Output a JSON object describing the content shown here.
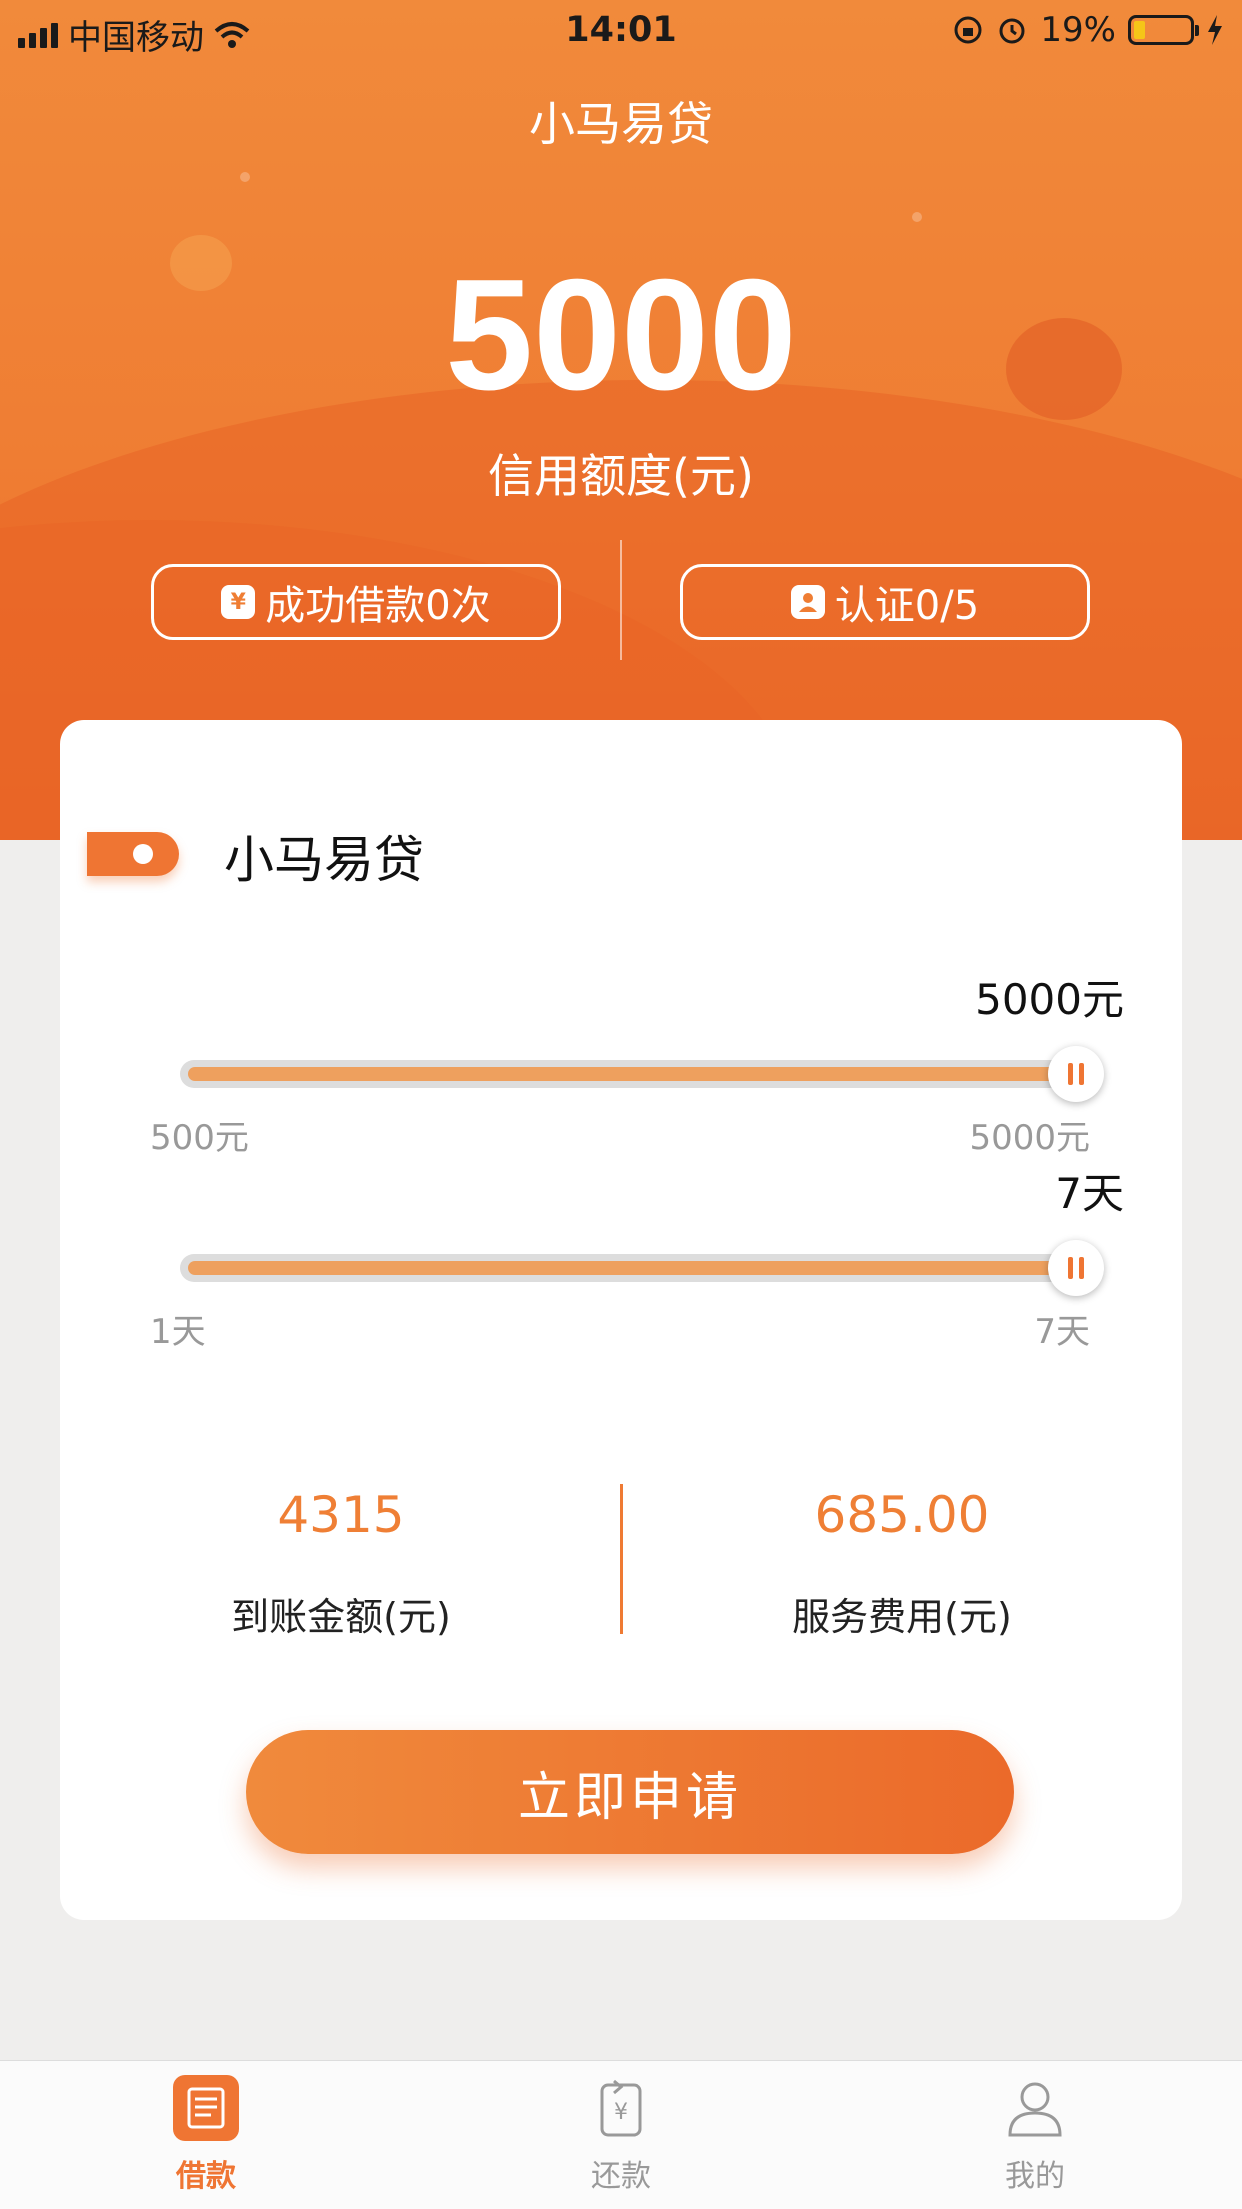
{
  "status_bar": {
    "carrier": "中国移动",
    "time": "14:01",
    "battery": "19%"
  },
  "header": {
    "app_title": "小马易贷",
    "credit_amount": "5000",
    "credit_label": "信用额度(元)",
    "loans_button": "成功借款0次",
    "auth_button": "认证0/5"
  },
  "card": {
    "title": "小马易贷",
    "amount_slider": {
      "value_label": "5000元",
      "min_label": "500元",
      "max_label": "5000元",
      "fraction": 1.0
    },
    "days_slider": {
      "value_label": "7天",
      "min_label": "1天",
      "max_label": "7天",
      "fraction": 1.0
    },
    "received": {
      "value": "4315",
      "label": "到账金额(元)"
    },
    "fee": {
      "value": "685.00",
      "label": "服务费用(元)"
    },
    "apply_button": "立即申请"
  },
  "tabbar": {
    "items": [
      {
        "label": "借款",
        "icon": "receipt-icon",
        "active": true
      },
      {
        "label": "还款",
        "icon": "repay-icon",
        "active": false
      },
      {
        "label": "我的",
        "icon": "profile-icon",
        "active": false
      }
    ]
  },
  "colors": {
    "accent": "#ef7533",
    "header_bg": "#ef7d33",
    "slider_fill": "#eea05e"
  }
}
